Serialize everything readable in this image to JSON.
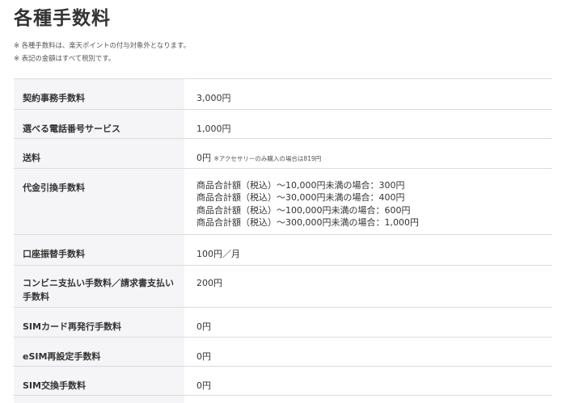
{
  "page": {
    "title": "各種手数料",
    "notes": [
      "※ 各種手数料は、楽天ポイントの付与対象外となります。",
      "※ 表記の金額はすべて税別です。"
    ]
  },
  "fees": {
    "rows": [
      {
        "label": "契約事務手数料",
        "value": "3,000円"
      },
      {
        "label": "選べる電話番号サービス",
        "value": "1,000円"
      },
      {
        "label": "送料",
        "value": "0円",
        "note": "※アクセサリーのみ購入の場合は819円"
      },
      {
        "label": "代金引換手数料",
        "lines": [
          "商品合計額（税込）～10,000円未満の場合：300円",
          "商品合計額（税込）～30,000円未満の場合：400円",
          "商品合計額（税込）～100,000円未満の場合：600円",
          "商品合計額（税込）～300,000円未満の場合：1,000円"
        ]
      },
      {
        "label": "口座振替手数料",
        "value": "100円／月"
      },
      {
        "label": "コンビニ支払い手数料／請求書支払い手数料",
        "value": "200円"
      },
      {
        "label": "SIMカード再発行手数料",
        "value": "0円"
      },
      {
        "label": "eSIM再設定手数料",
        "value": "0円"
      },
      {
        "label": "SIM交換手数料",
        "value": "0円"
      }
    ]
  }
}
